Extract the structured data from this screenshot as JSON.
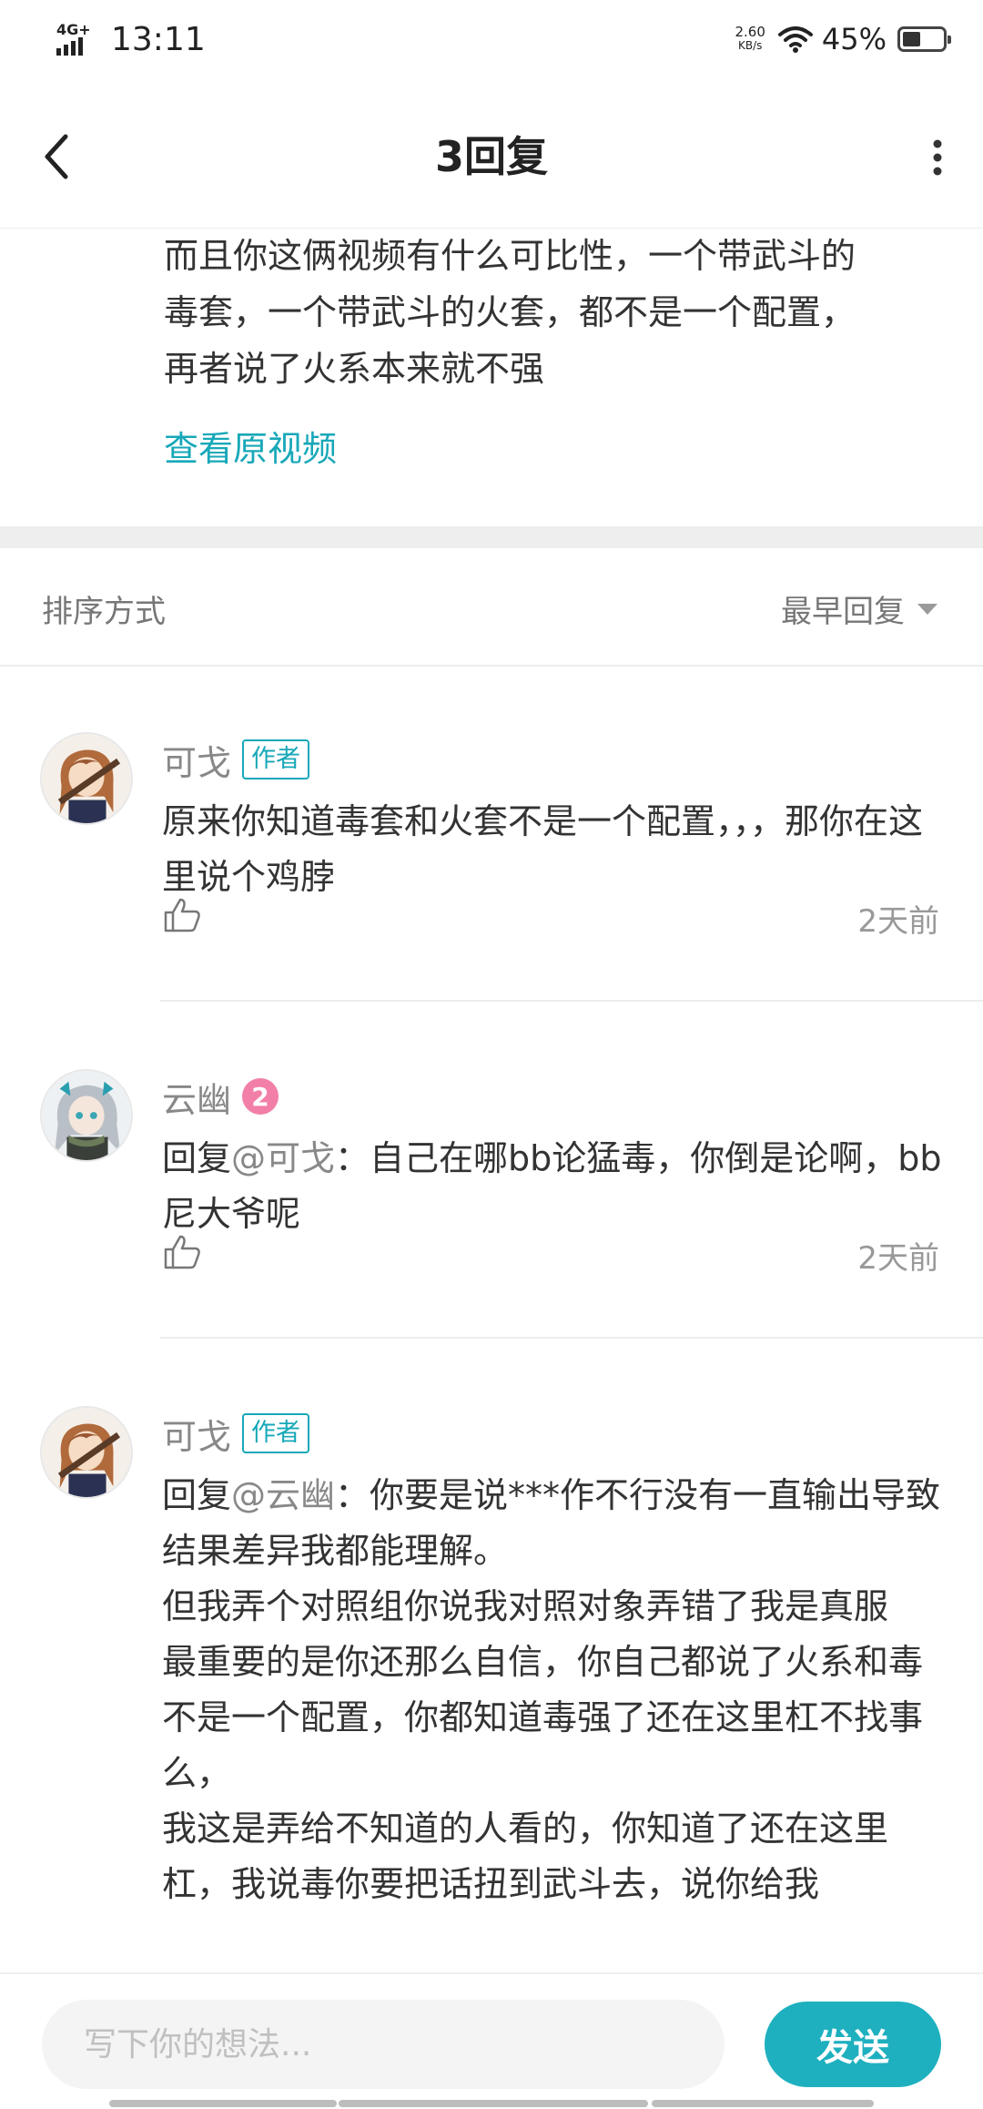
{
  "status_bar": {
    "network": "4G+",
    "time": "13:11",
    "speed_value": "2.60",
    "speed_unit": "KB/s",
    "battery_percent": "45%",
    "battery_level": 0.45
  },
  "header": {
    "title": "3回复"
  },
  "original": {
    "lines": [
      "而且你这俩视频有什么可比性，一个带武斗的",
      "毒套，一个带武斗的火套，都不是一个配置，",
      "再者说了火系本来就不强"
    ],
    "view_original": "查看原视频"
  },
  "sort": {
    "label": "排序方式",
    "selected": "最早回复"
  },
  "replies": [
    {
      "name": "可戈",
      "badge": "作者",
      "text": "原来你知道毒套和火套不是一个配置，，，那你在这里说个鸡脖",
      "time": "2天前"
    },
    {
      "name": "云幽",
      "level": "2",
      "reply_prefix": "回复",
      "mention": "@可戈",
      "text": "：自己在哪bb论猛毒，你倒是论啊，bb尼大爷呢",
      "time": "2天前"
    },
    {
      "name": "可戈",
      "badge": "作者",
      "reply_prefix": "回复",
      "mention": "@云幽",
      "text_first": "：你要是说***作不行没有一直输出导致结果差异我都能理解。",
      "lines": [
        "但我弄个对照组你说我对照对象弄错了我是真服",
        "最重要的是你还那么自信，你自己都说了火系和毒不是一个配置，你都知道毒强了还在这里杠不找事么，",
        "我这是弄给不知道的人看的，你知道了还在这里杠，我说毒你要把话扭到武斗去，说你给我"
      ]
    }
  ],
  "composer": {
    "placeholder": "写下你的想法...",
    "send_label": "发送"
  },
  "colors": {
    "accent": "#17a8b8",
    "send_button": "#1eb0bf",
    "level_badge": "#f27fa8"
  }
}
